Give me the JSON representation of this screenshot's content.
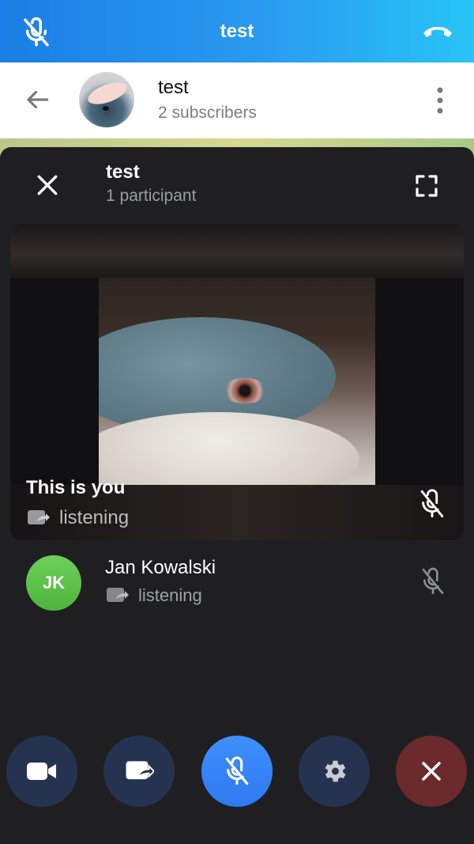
{
  "topbar": {
    "title": "test",
    "mic_icon": "mic-off-icon",
    "hangup_icon": "hang-up-icon"
  },
  "chat_header": {
    "name": "test",
    "subscribers": "2 subscribers",
    "back_icon": "arrow-left-icon",
    "menu_icon": "more-vertical-icon"
  },
  "call_panel": {
    "title": "test",
    "participant_count": "1 participant"
  },
  "self_tile": {
    "label": "This is you",
    "status": "listening"
  },
  "participants": [
    {
      "initials": "JK",
      "name": "Jan Kowalski",
      "status": "listening"
    }
  ],
  "controls": [
    {
      "name": "video-button",
      "icon": "video-camera-icon"
    },
    {
      "name": "screen-share-button",
      "icon": "screen-share-icon"
    },
    {
      "name": "mute-button",
      "icon": "mic-off-icon"
    },
    {
      "name": "settings-button",
      "icon": "gear-icon"
    },
    {
      "name": "leave-button",
      "icon": "close-icon"
    }
  ],
  "colors": {
    "header_gradient_start": "#1b7ee6",
    "header_gradient_end": "#28c4f6",
    "panel_background": "#1f1f21",
    "mute_accent": "#3f90ff",
    "leave_red": "#6b2a2c",
    "participant_avatar": "#5cbf49"
  }
}
